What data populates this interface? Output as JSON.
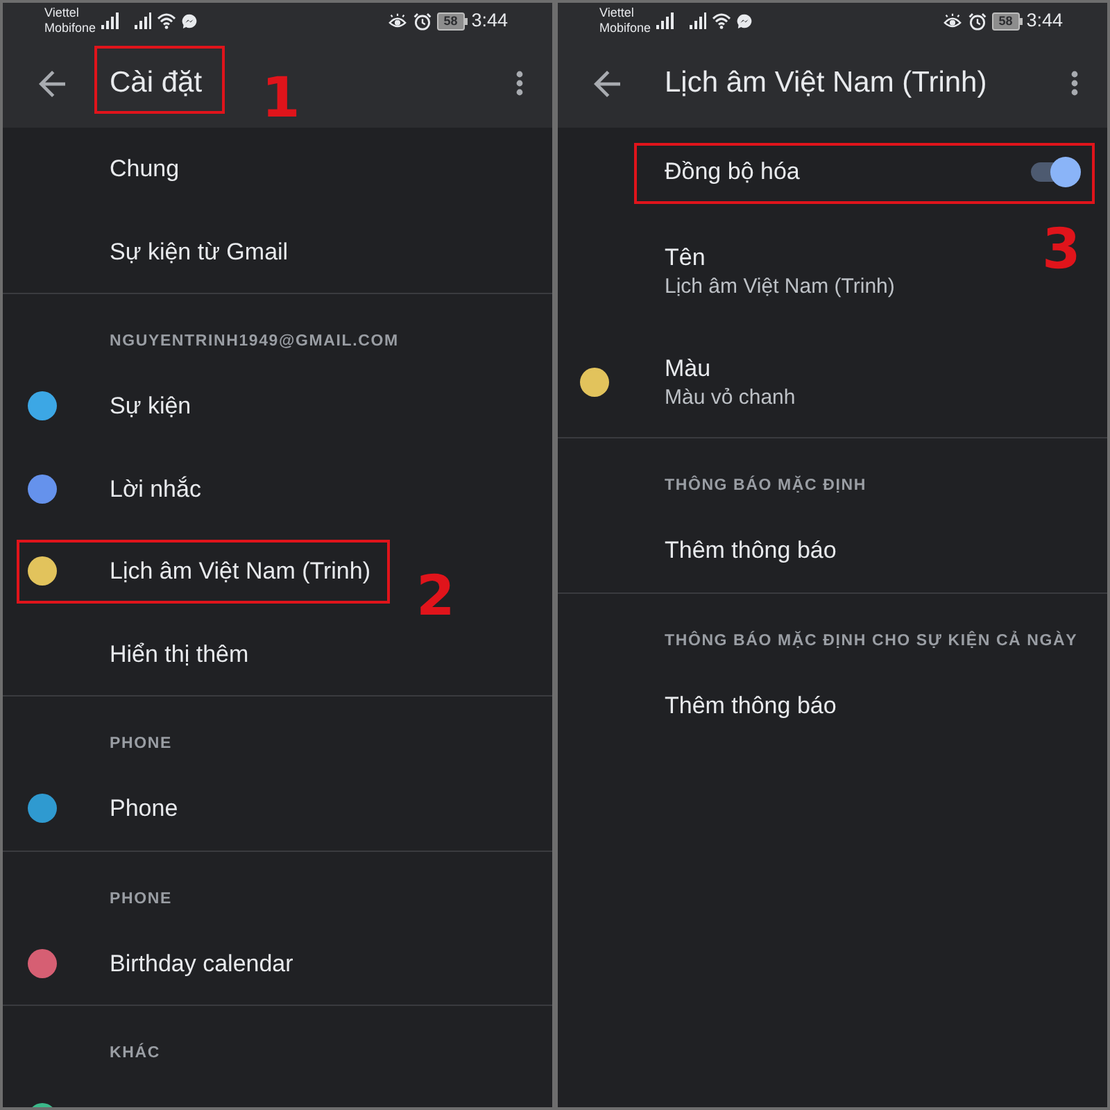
{
  "screens": [
    {
      "status_bar": {
        "carriers": [
          "Viettel",
          "Mobifone"
        ],
        "battery": "58",
        "time": "3:44"
      },
      "app_bar": {
        "title": "Cài đặt",
        "annotation": "1"
      },
      "sections": [
        {
          "items": [
            {
              "kind": "plain",
              "label": "Chung"
            },
            {
              "kind": "plain",
              "label": "Sự kiện từ Gmail"
            }
          ]
        },
        {
          "header": "NGUYENTRINH1949@GMAIL.COM",
          "items": [
            {
              "kind": "plain",
              "label": "Sự kiện",
              "color": "#3ca7e5"
            },
            {
              "kind": "plain",
              "label": "Lời nhắc",
              "color": "#6592ec"
            },
            {
              "kind": "plain",
              "label": "Lịch âm Việt Nam (Trinh)",
              "color": "#e2c35c",
              "annotation": "2"
            },
            {
              "kind": "plain",
              "label": "Hiển thị thêm"
            }
          ]
        },
        {
          "header": "PHONE",
          "items": [
            {
              "kind": "plain",
              "label": "Phone",
              "color": "#2f9ad0"
            }
          ]
        },
        {
          "header": "PHONE",
          "items": [
            {
              "kind": "plain",
              "label": "Birthday calendar",
              "color": "#d65f73"
            }
          ]
        },
        {
          "header": "KHÁC",
          "items": [
            {
              "kind": "plain",
              "color": "#3bb98a"
            }
          ]
        }
      ]
    },
    {
      "status_bar": {
        "carriers": [
          "Viettel",
          "Mobifone"
        ],
        "battery": "58",
        "time": "3:44"
      },
      "app_bar": {
        "title": "Lịch âm Việt Nam (Trinh)"
      },
      "sections": [
        {
          "items": [
            {
              "kind": "switch",
              "label": "Đồng bộ hóa",
              "on": true,
              "annotation": "3"
            },
            {
              "kind": "detail",
              "label": "Tên",
              "value": "Lịch âm Việt Nam (Trinh)"
            },
            {
              "kind": "detail",
              "label": "Màu",
              "value": "Màu vỏ chanh",
              "color": "#e2c35c"
            }
          ]
        },
        {
          "header": "THÔNG BÁO MẶC ĐỊNH",
          "items": [
            {
              "kind": "plain",
              "label": "Thêm thông báo"
            }
          ]
        },
        {
          "header": "THÔNG BÁO MẶC ĐỊNH CHO SỰ KIỆN CẢ NGÀY",
          "items": [
            {
              "kind": "plain",
              "label": "Thêm thông báo"
            }
          ]
        }
      ]
    }
  ]
}
